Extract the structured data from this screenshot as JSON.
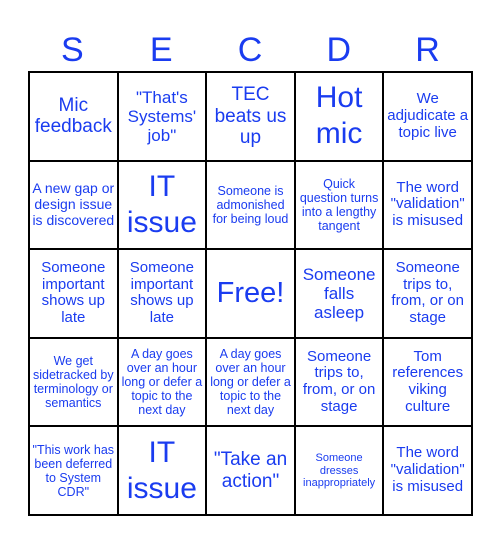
{
  "header": {
    "letters": [
      "S",
      "E",
      "C",
      "D",
      "R"
    ]
  },
  "colors": {
    "text": "#1a3cf0",
    "grid": "#000000",
    "background": "#ffffff"
  },
  "board": {
    "rows": [
      [
        "Mic feedback",
        "\"That's Systems' job\"",
        "TEC beats us up",
        "Hot mic",
        "We adjudicate a topic live"
      ],
      [
        "A new gap or design issue is discovered",
        "IT issue",
        "Someone is admonished for being loud",
        "Quick question turns into a lengthy tangent",
        "The word \"validation\" is misused"
      ],
      [
        "Someone important shows up late",
        "Someone important shows up late",
        "Free!",
        "Someone falls asleep",
        "Someone trips to, from, or on stage"
      ],
      [
        "We get sidetracked by terminology or semantics",
        "A day goes over an hour long or defer a topic to the next day",
        "A day goes over an hour long or defer a topic to the next day",
        "Someone trips to, from, or on stage",
        "Tom references viking culture"
      ],
      [
        "\"This work has been deferred to System CDR\"",
        "IT issue",
        "\"Take an action\"",
        "Someone dresses inappropriately",
        "The word \"validation\" is misused"
      ]
    ]
  }
}
